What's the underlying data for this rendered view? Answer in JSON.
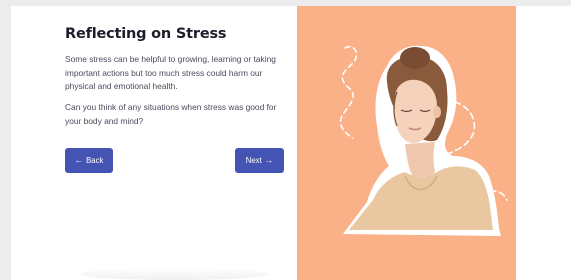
{
  "slide": {
    "title": "Reflecting on Stress",
    "paragraph_1": "Some stress can be helpful to growing, learning or taking important actions but too much stress could harm our physical and emotional health.",
    "paragraph_2": "Can you think of any situations when stress was good for your body and mind?"
  },
  "navigation": {
    "back_label": "Back",
    "next_label": "Next",
    "back_icon": "arrow-left-icon",
    "next_icon": "arrow-right-icon"
  },
  "colors": {
    "accent_button": "#4354b3",
    "illustration_background": "#fbb187",
    "title_text": "#1d1d2b",
    "body_text": "#4b4b5c"
  }
}
